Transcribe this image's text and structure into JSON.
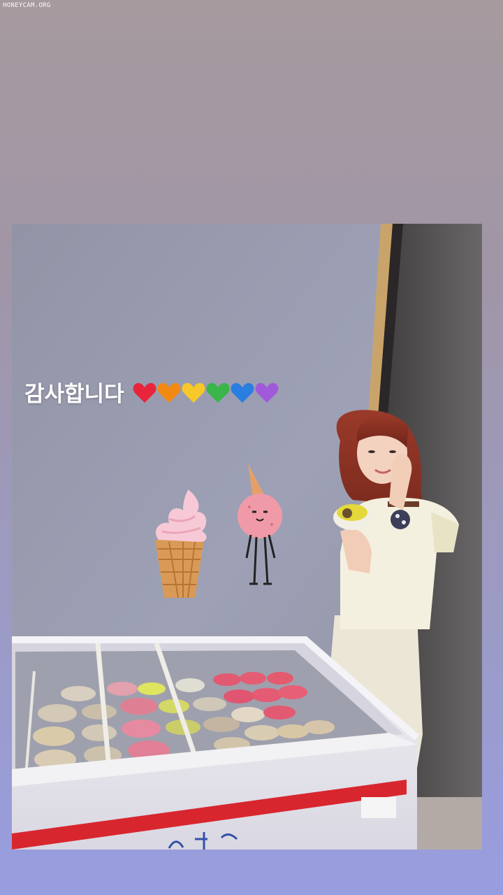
{
  "watermark": "HONEYCAM.ORG",
  "story": {
    "caption": "감사합니다",
    "hearts": [
      "red",
      "orange",
      "yellow",
      "green",
      "blue",
      "purple"
    ],
    "stickers": [
      "soft-serve-cone-icon",
      "walking-ice-cream-scoop-icon"
    ]
  },
  "freezer": {
    "sign_text": "~"
  },
  "colors": {
    "heart_red": "#e8253a",
    "heart_orange": "#f28a12",
    "heart_yellow": "#f7c82a",
    "heart_green": "#39b54a",
    "heart_blue": "#2a7de1",
    "heart_purple": "#a05ad9",
    "freezer_stripe": "#d8262f"
  }
}
